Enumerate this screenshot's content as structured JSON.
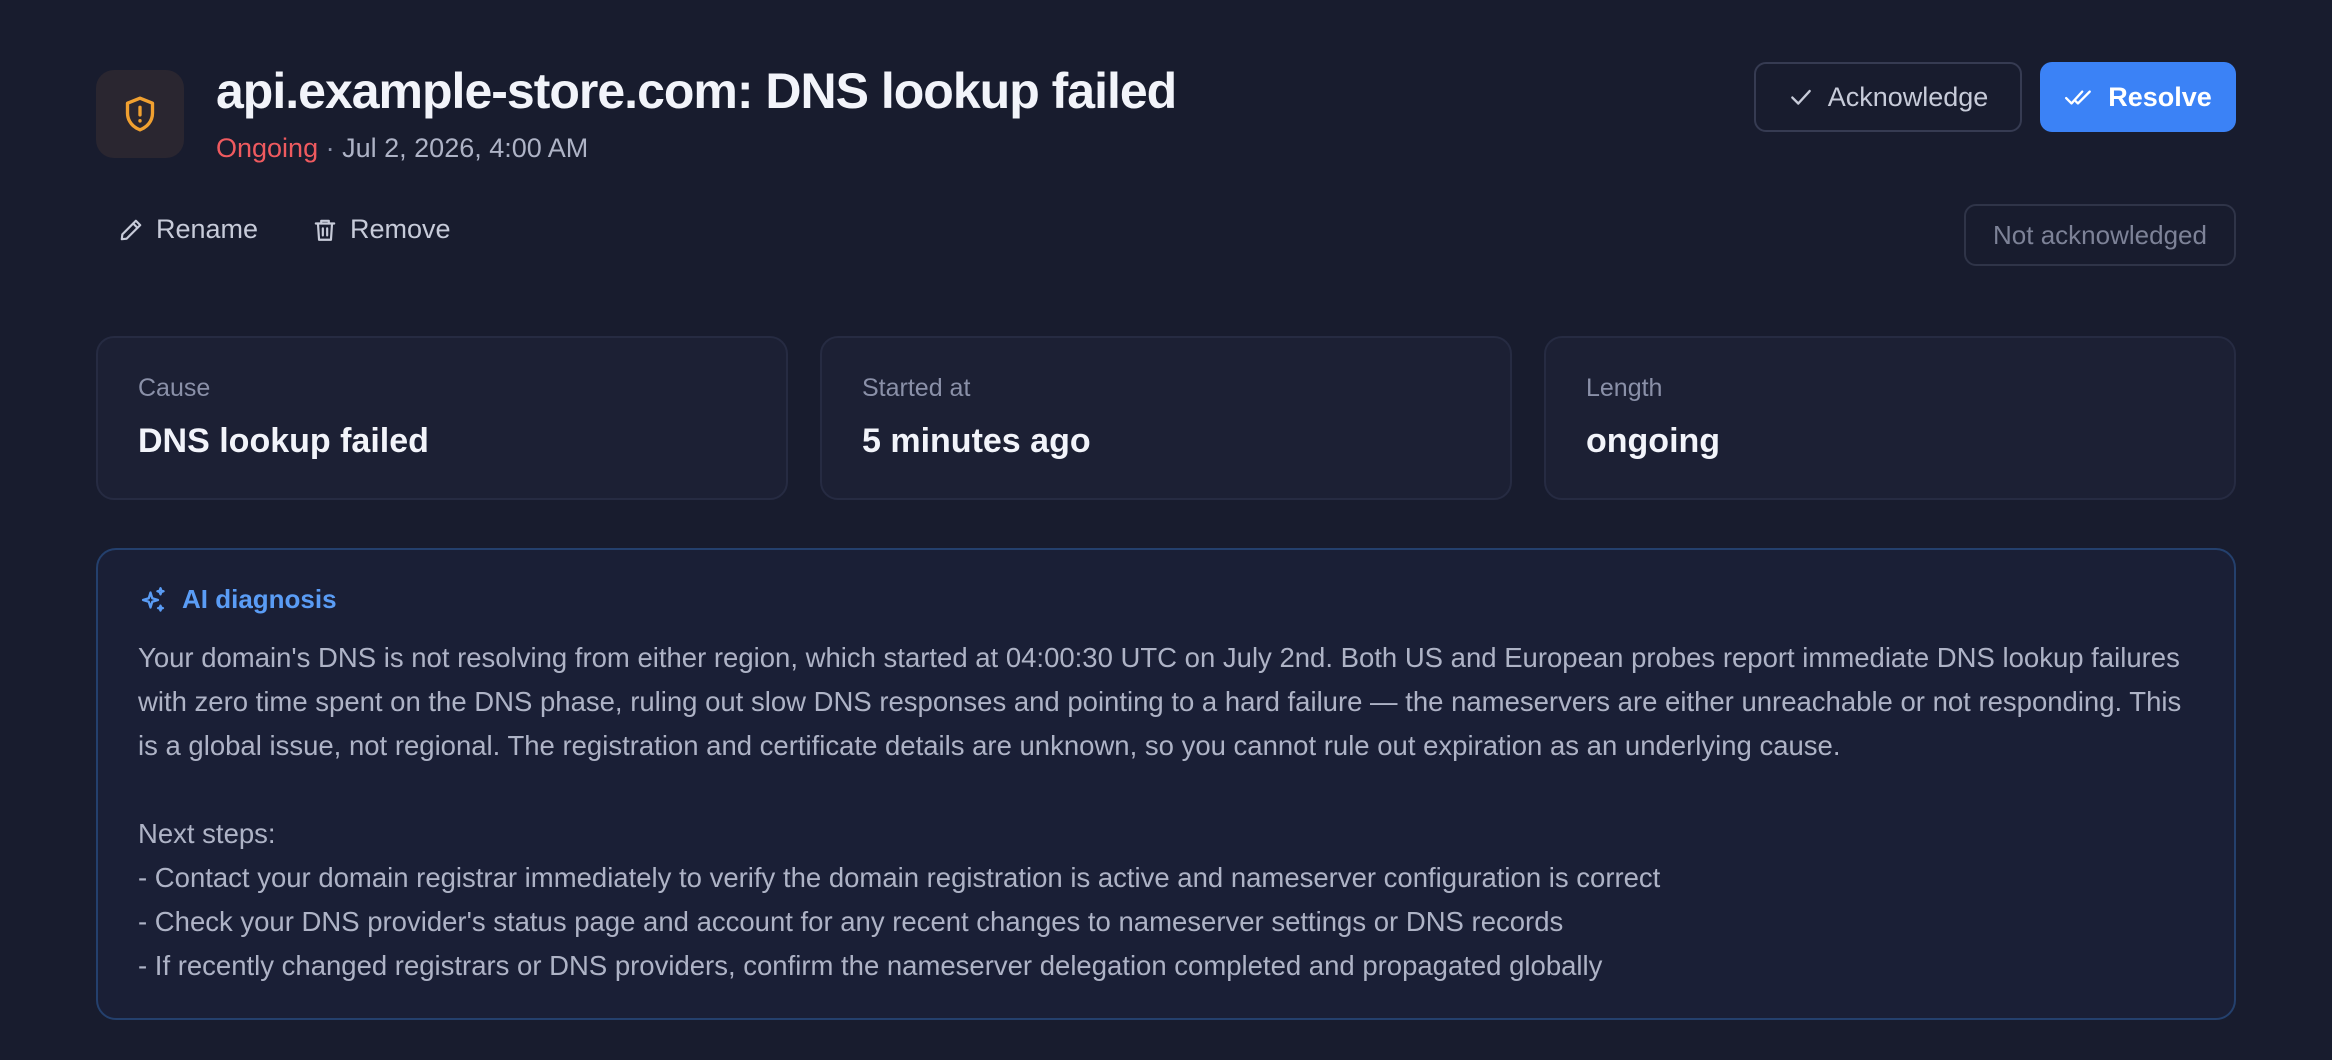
{
  "header": {
    "title": "api.example-store.com: DNS lookup failed",
    "status": "Ongoing",
    "separator": "·",
    "date": "Jul 2, 2026, 4:00 AM",
    "acknowledge_label": "Acknowledge",
    "resolve_label": "Resolve"
  },
  "actions": {
    "rename_label": "Rename",
    "remove_label": "Remove",
    "ack_status": "Not acknowledged"
  },
  "cards": [
    {
      "label": "Cause",
      "value": "DNS lookup failed"
    },
    {
      "label": "Started at",
      "value": "5 minutes ago"
    },
    {
      "label": "Length",
      "value": "ongoing"
    }
  ],
  "ai": {
    "title": "AI diagnosis",
    "summary": "Your domain's DNS is not resolving from either region, which started at 04:00:30 UTC on July 2nd. Both US and European probes report immediate DNS lookup failures with zero time spent on the DNS phase, ruling out slow DNS responses and pointing to a hard failure — the nameservers are either unreachable or not responding. This is a global issue, not regional. The registration and certificate details are unknown, so you cannot rule out expiration as an underlying cause.",
    "next_steps_title": "Next steps:",
    "steps": [
      "- Contact your domain registrar immediately to verify the domain registration is active and nameserver configuration is correct",
      "- Check your DNS provider's status page and account for any recent changes to nameserver settings or DNS records",
      "- If recently changed registrars or DNS providers, confirm the nameserver delegation completed and propagated globally"
    ]
  },
  "colors": {
    "background": "#181c2e",
    "accent": "#3b82f6",
    "ongoing": "#ef5a5f",
    "warning": "#f0a030",
    "ai_accent": "#5a9cf5"
  },
  "icons": {
    "header": "shield-alert-icon",
    "acknowledge": "check-icon",
    "resolve": "double-check-icon",
    "rename": "pencil-icon",
    "remove": "trash-icon",
    "ai": "sparkles-icon"
  }
}
